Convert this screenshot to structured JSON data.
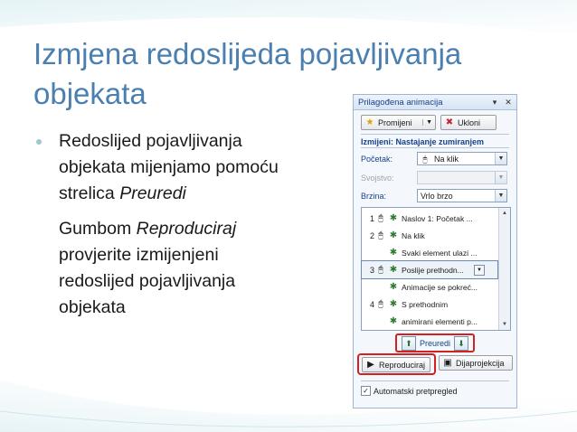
{
  "slide": {
    "title": "Izmjena redoslijeda pojavljivanja objekata",
    "bullet1": {
      "line1": "Redoslijed pojavljivanja",
      "line2": "objekata mijenjamo pomoću",
      "line3_plain": "strelica ",
      "line3_italic": "Preuredi"
    },
    "bullet2": {
      "line1_plain": "Gumbom ",
      "line1_italic": "Reproduciraj",
      "line2": "provjerite izmijenjeni",
      "line3": "redoslijed pojavljivanja",
      "line4": "objekata"
    }
  },
  "pane": {
    "title": "Prilagođena animacija",
    "change_button": "Promijeni",
    "remove_button": "Ukloni",
    "modify_label": "Izmijeni: Nastajanje zumiranjem",
    "start_label": "Početak:",
    "start_value": "Na klik",
    "property_label": "Svojstvo:",
    "speed_label": "Brzina:",
    "speed_value": "Vrlo brzo",
    "items": [
      {
        "num": "1",
        "mouse": true,
        "text": "Naslov 1: Početak ..."
      },
      {
        "num": "2",
        "mouse": true,
        "text": "Na klik"
      },
      {
        "num": "",
        "mouse": false,
        "text": "Svaki element ulazi ..."
      },
      {
        "num": "3",
        "mouse": true,
        "text": "Poslije prethodn...",
        "selected": true
      },
      {
        "num": "",
        "mouse": false,
        "text": "Animacije se pokreć..."
      },
      {
        "num": "4",
        "mouse": true,
        "text": "S prethodnim"
      },
      {
        "num": "",
        "mouse": false,
        "text": "animirani elementi p..."
      }
    ],
    "reorder_label": "Preuredi",
    "play_button": "Reproduciraj",
    "slideshow_button": "Dijaprojekcija",
    "autopreview_label": "Automatski pretpregled",
    "autopreview_checked": true
  }
}
